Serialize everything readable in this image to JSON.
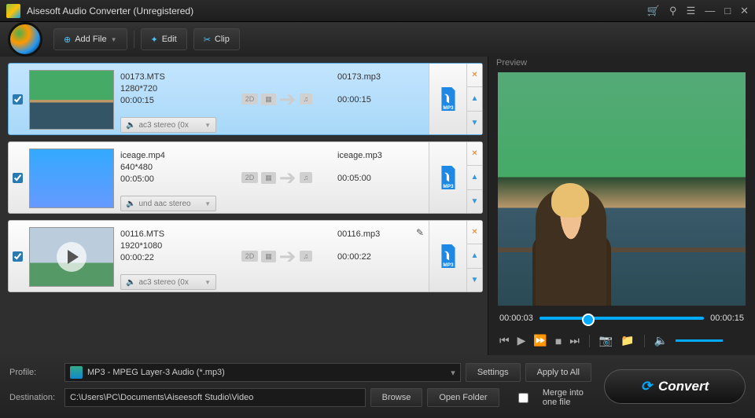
{
  "title": "Aisesoft Audio Converter (Unregistered)",
  "toolbar": {
    "add": "Add File",
    "edit": "Edit",
    "clip": "Clip"
  },
  "items": [
    {
      "selected": true,
      "checked": true,
      "name": "00173.MTS",
      "res": "1280*720",
      "dur": "00:00:15",
      "audio": "ac3 stereo (0x",
      "out_name": "00173.mp3",
      "out_dur": "00:00:15",
      "has_play": false,
      "has_pencil": false,
      "thumb_class": "t1"
    },
    {
      "selected": false,
      "checked": true,
      "name": "iceage.mp4",
      "res": "640*480",
      "dur": "00:05:00",
      "audio": "und aac stereo",
      "out_name": "iceage.mp3",
      "out_dur": "00:05:00",
      "has_play": false,
      "has_pencil": false,
      "thumb_class": "t2"
    },
    {
      "selected": false,
      "checked": true,
      "name": "00116.MTS",
      "res": "1920*1080",
      "dur": "00:00:22",
      "audio": "ac3 stereo (0x",
      "out_name": "00116.mp3",
      "out_dur": "00:00:22",
      "has_play": true,
      "has_pencil": true,
      "thumb_class": "t3"
    }
  ],
  "preview": {
    "label": "Preview",
    "cur": "00:00:03",
    "total": "00:00:15"
  },
  "bottom": {
    "profile_lbl": "Profile:",
    "profile_val": "MP3 - MPEG Layer-3 Audio (*.mp3)",
    "settings": "Settings",
    "apply": "Apply to All",
    "dest_lbl": "Destination:",
    "dest_val": "C:\\Users\\PC\\Documents\\Aiseesoft Studio\\Video",
    "browse": "Browse",
    "open": "Open Folder",
    "merge": "Merge into one file",
    "convert": "Convert"
  }
}
